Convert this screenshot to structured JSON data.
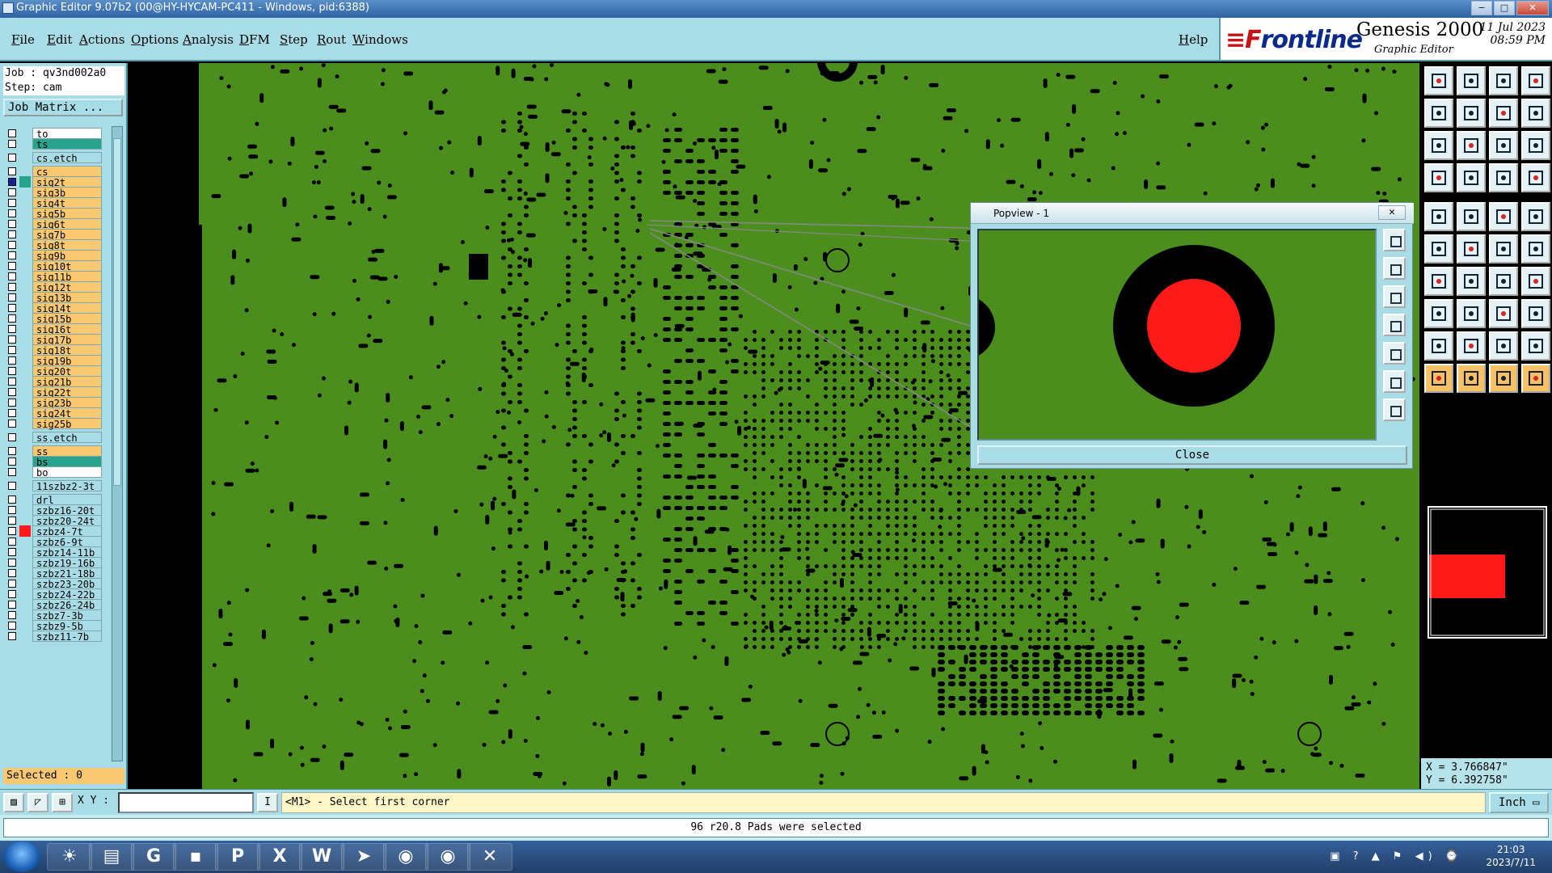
{
  "window": {
    "title": "Graphic Editor 9.07b2 (00@HY-HYCAM-PC411 - Windows, pid:6388)",
    "min": "−",
    "max": "□",
    "close": "✕"
  },
  "menu": {
    "items": [
      "File",
      "Edit",
      "Actions",
      "Options",
      "Analysis",
      "DFM",
      "Step",
      "Rout",
      "Windows"
    ],
    "help": "Help"
  },
  "brand": {
    "logo_a": "≡F",
    "logo_b": "rontline",
    "product": "Genesis 2000",
    "subtitle": "Graphic Editor",
    "date": "11 Jul 2023",
    "time": "08:59 PM"
  },
  "job": {
    "job_label": "Job : qv3nd002a0",
    "step_label": "Step: cam",
    "matrix_button": "Job Matrix ..."
  },
  "layers": [
    {
      "name": "to",
      "color": "#ffffff"
    },
    {
      "name": "ts",
      "color": "#2aa38c"
    },
    {
      "name": "cs.etch",
      "color": "#a8dce6"
    },
    {
      "name": "cs",
      "color": "#f9c870"
    },
    {
      "name": "sig2t",
      "color": "#f9c870",
      "active": true
    },
    {
      "name": "sig3b",
      "color": "#f9c870"
    },
    {
      "name": "sig4t",
      "color": "#f9c870"
    },
    {
      "name": "sig5b",
      "color": "#f9c870"
    },
    {
      "name": "sig6t",
      "color": "#f9c870"
    },
    {
      "name": "sig7b",
      "color": "#f9c870"
    },
    {
      "name": "sig8t",
      "color": "#f9c870"
    },
    {
      "name": "sig9b",
      "color": "#f9c870"
    },
    {
      "name": "sig10t",
      "color": "#f9c870"
    },
    {
      "name": "sig11b",
      "color": "#f9c870"
    },
    {
      "name": "sig12t",
      "color": "#f9c870"
    },
    {
      "name": "sig13b",
      "color": "#f9c870"
    },
    {
      "name": "sig14t",
      "color": "#f9c870"
    },
    {
      "name": "sig15b",
      "color": "#f9c870"
    },
    {
      "name": "sig16t",
      "color": "#f9c870"
    },
    {
      "name": "sig17b",
      "color": "#f9c870"
    },
    {
      "name": "sig18t",
      "color": "#f9c870"
    },
    {
      "name": "sig19b",
      "color": "#f9c870"
    },
    {
      "name": "sig20t",
      "color": "#f9c870"
    },
    {
      "name": "sig21b",
      "color": "#f9c870"
    },
    {
      "name": "sig22t",
      "color": "#f9c870"
    },
    {
      "name": "sig23b",
      "color": "#f9c870"
    },
    {
      "name": "sig24t",
      "color": "#f9c870"
    },
    {
      "name": "sig25b",
      "color": "#f9c870"
    },
    {
      "name": "ss.etch",
      "color": "#a8dce6"
    },
    {
      "name": "ss",
      "color": "#f9c870"
    },
    {
      "name": "bs",
      "color": "#2aa38c"
    },
    {
      "name": "bo",
      "color": "#ffffff"
    },
    {
      "name": "11szbz2-3t",
      "color": "#a8dce6"
    },
    {
      "name": "drl",
      "color": "#a8dce6"
    },
    {
      "name": "szbz16-20t",
      "color": "#a8dce6"
    },
    {
      "name": "szbz20-24t",
      "color": "#a8dce6"
    },
    {
      "name": "szbz4-7t",
      "color": "#a8dce6",
      "work": true
    },
    {
      "name": "szbz6-9t",
      "color": "#a8dce6"
    },
    {
      "name": "szbz14-11b",
      "color": "#a8dce6"
    },
    {
      "name": "szbz19-16b",
      "color": "#a8dce6"
    },
    {
      "name": "szbz21-18b",
      "color": "#a8dce6"
    },
    {
      "name": "szbz23-20b",
      "color": "#a8dce6"
    },
    {
      "name": "szbz24-22b",
      "color": "#a8dce6"
    },
    {
      "name": "szbz26-24b",
      "color": "#a8dce6"
    },
    {
      "name": "szbz7-3b",
      "color": "#a8dce6"
    },
    {
      "name": "szbz9-5b",
      "color": "#a8dce6"
    },
    {
      "name": "szbz11-7b",
      "color": "#a8dce6"
    }
  ],
  "selected": "Selected : 0",
  "popview": {
    "title": "Popview - 1",
    "close_x": "✕",
    "close_button": "Close"
  },
  "coords": {
    "x": "X = 3.766847\"",
    "y": "Y = 6.392758\""
  },
  "status": {
    "xy_label": "X Y :",
    "xy_value": "",
    "prompt": "<M1> - Select first corner",
    "unit": "Inch ▭",
    "message": "96 r20.8 Pads were selected"
  },
  "taskbar": {
    "time": "21:03",
    "date": "2023/7/11",
    "apps": [
      "☀",
      "▤",
      "G",
      "▪",
      "P",
      "X",
      "W",
      "➤",
      "◉",
      "◉",
      "✕"
    ],
    "tray": "▣ ? ▲ ⚑ ◀) ⌚"
  },
  "colors": {
    "board": "#4b8e1d",
    "feature": "#000000",
    "highlight": "#ff1a1a",
    "panel": "#a8dce6",
    "layer": "#f9c870"
  },
  "toolbox_icons": [
    "hand-icon",
    "zoom-icon",
    "home-icon",
    "layout-icon",
    "prev-icon",
    "next-icon",
    "step-icon",
    "pan-icon",
    "fit-icon",
    "center-icon",
    "scale-icon",
    "help-icon",
    "measure-icon",
    "snap-icon",
    "pad-icon",
    "grid-icon",
    "camera-icon",
    "erase-icon",
    "ruler-icon",
    "select-icon",
    "join-icon",
    "cross-icon",
    "split-icon",
    "move-icon",
    "arc-icon",
    "line-icon",
    "rotate-icon",
    "mirror-icon",
    "ref-icon",
    "dash-icon",
    "dim-icon",
    "copy-icon",
    "tri-icon",
    "tri2-icon",
    "tri3-icon",
    "tri4-icon",
    "pointer-icon",
    "pointer2-icon",
    "pointer3-icon",
    "pointer4-icon"
  ]
}
